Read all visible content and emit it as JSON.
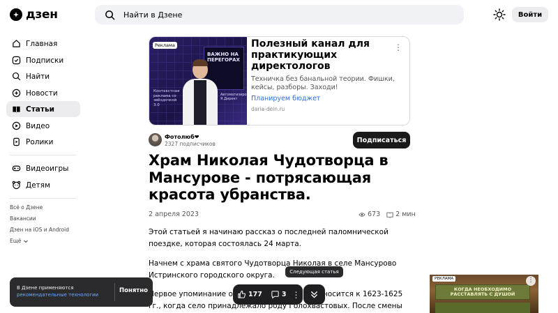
{
  "header": {
    "logo": "дзен",
    "search_placeholder": "Найти в Дзене",
    "login_label": "Войти"
  },
  "sidebar": {
    "items": [
      {
        "label": "Главная",
        "icon": "home-icon"
      },
      {
        "label": "Подписки",
        "icon": "subscriptions-icon"
      },
      {
        "label": "Найти",
        "icon": "search-icon"
      },
      {
        "label": "Новости",
        "icon": "news-icon"
      },
      {
        "label": "Статьи",
        "icon": "articles-icon",
        "active": true
      },
      {
        "label": "Видео",
        "icon": "video-icon"
      },
      {
        "label": "Ролики",
        "icon": "shorts-icon"
      }
    ],
    "items2": [
      {
        "label": "Видеоигры",
        "icon": "gamepad-icon"
      },
      {
        "label": "Детям",
        "icon": "kids-icon"
      }
    ],
    "footer": [
      "Всё о Дзене",
      "Вакансии",
      "Дзен на iOS и Android",
      "Ещё"
    ]
  },
  "ad": {
    "badge": "Реклама",
    "image_caption": "Контекстная реклама со звёздочкой 3.0",
    "image_screen_text": "ВАЖНО НА ПЕРЕГОРАХ",
    "image_caption2": "Автоматизированные Я.Директ",
    "title": "Полезный канал для практикующих директологов",
    "description": "Техничка без банальной теории. Фишки, кейсы, разборы. Заходи!",
    "cta": "Планируем бюджет",
    "domain": "daria-dein.ru"
  },
  "channel": {
    "name": "Фотолюб❤",
    "subscribers": "2327 подписчиков",
    "subscribe_label": "Подписаться"
  },
  "article": {
    "title": "Храм Николая Чудотворца в Мансурове - потрясающая красота убранства.",
    "date": "2 апреля 2023",
    "views": "673",
    "read_time": "2 мин",
    "paragraphs": [
      "Этой статьей я начинаю рассказ о последней паломнической поездке, которая состоялась 24 марта.",
      "Начнем с храма святого Чудотворца Николая в селе Мансурово Истринского городского округа.",
      "Первое упоминание о деревне Мансурово относится к 1623-1625 гг., когда село принадлежало роду Голохвастовых. После смены многочисленных"
    ]
  },
  "cookie": {
    "text": "В Дзене применяются",
    "link": "рекомендательные технологии",
    "button": "Понятно"
  },
  "floating": {
    "tooltip": "Следующая статья",
    "likes": "177",
    "comments": "3"
  },
  "right_ad": {
    "badge": "РЕКЛАМА",
    "headline": "КОГДА НЕОБХОДИМО РАССТАВЛЯТЬ С ДУШОЙ"
  }
}
